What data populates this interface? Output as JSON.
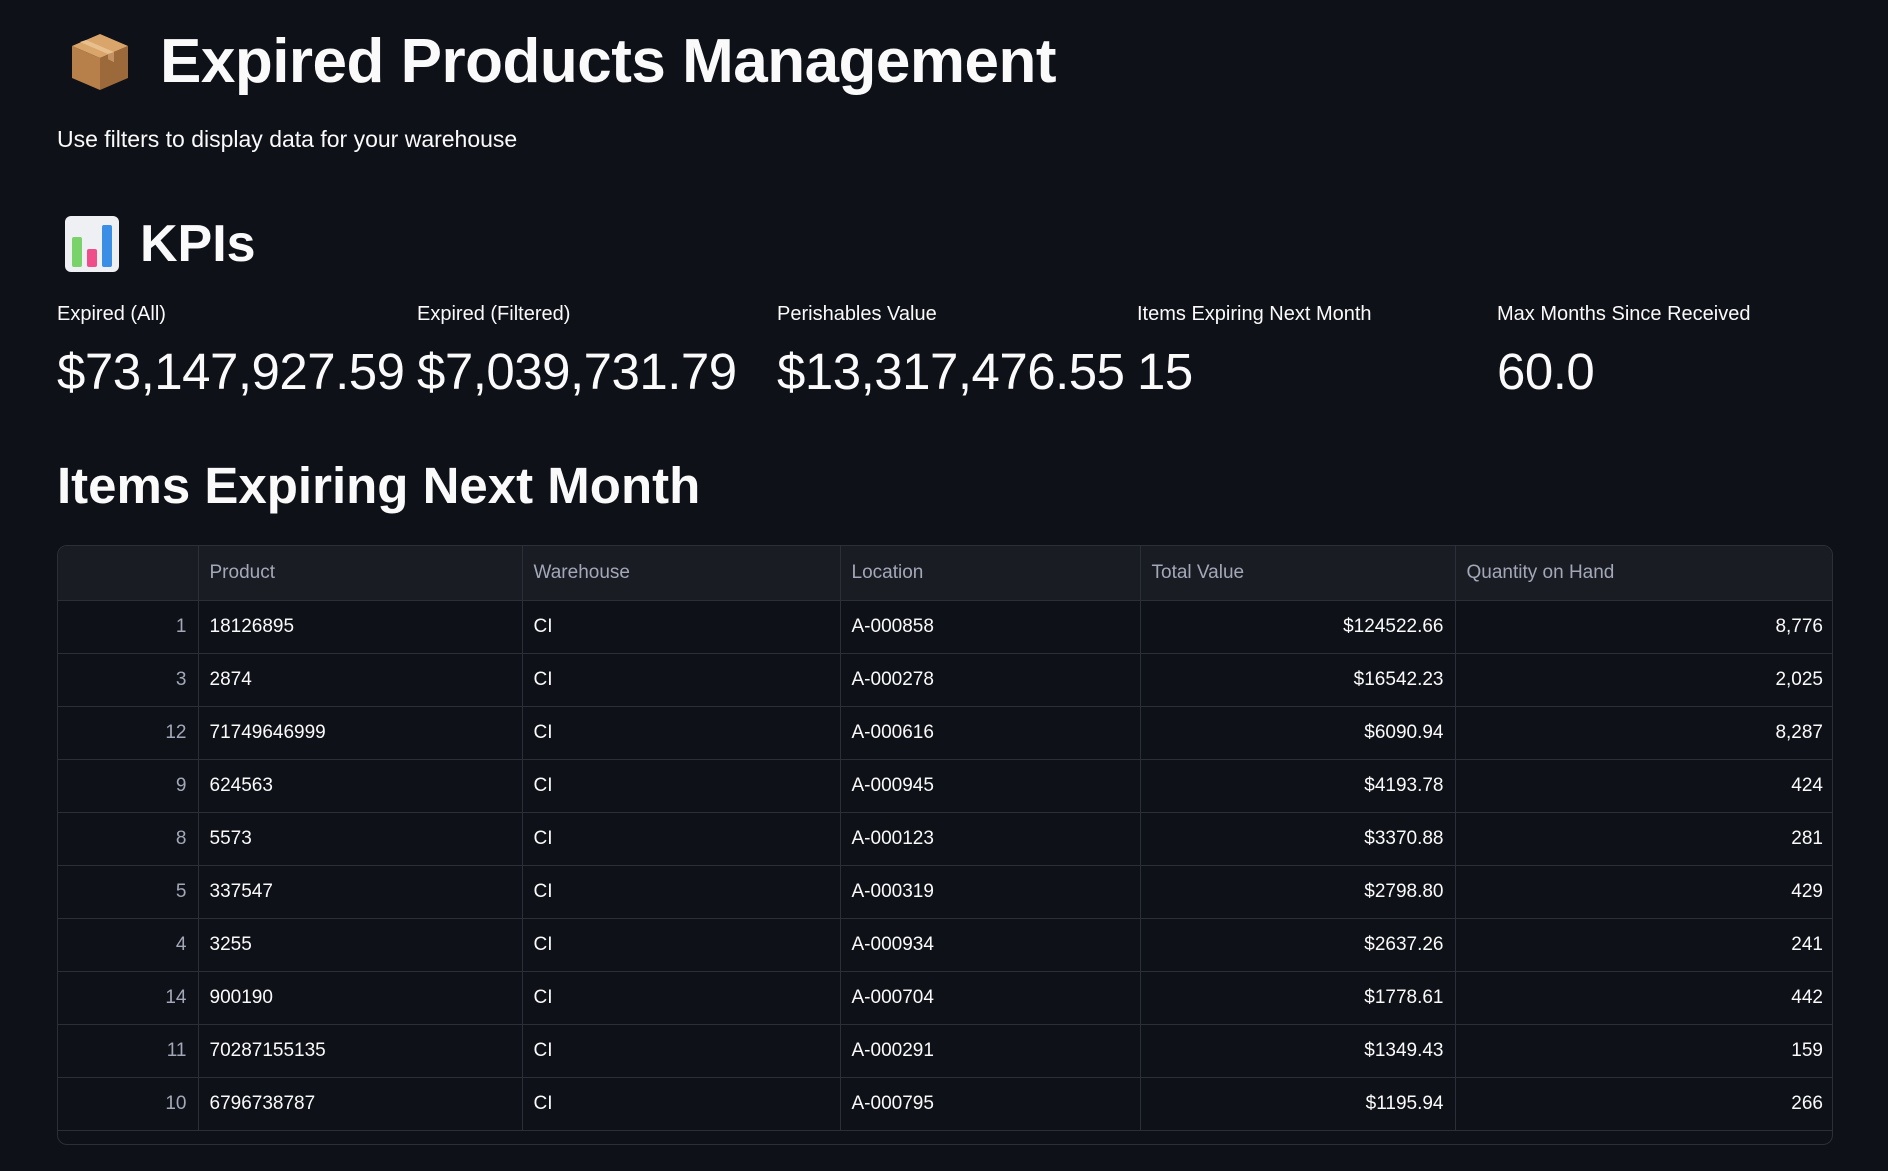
{
  "header": {
    "title": "Expired Products Management",
    "title_icon": "package-icon",
    "subtitle": "Use filters to display data for your warehouse"
  },
  "kpis": {
    "heading": "KPIs",
    "heading_icon": "bar-chart-icon",
    "metrics": [
      {
        "label": "Expired (All)",
        "value": "$73,147,927.59"
      },
      {
        "label": "Expired (Filtered)",
        "value": "$7,039,731.79"
      },
      {
        "label": "Perishables Value",
        "value": "$13,317,476.55"
      },
      {
        "label": "Items Expiring Next Month",
        "value": "15"
      },
      {
        "label": "Max Months Since Received",
        "value": "60.0"
      }
    ]
  },
  "expiring": {
    "heading": "Items Expiring Next Month",
    "columns": [
      "",
      "Product",
      "Warehouse",
      "Location",
      "Total Value",
      "Quantity on Hand"
    ],
    "rows": [
      {
        "index": "1",
        "product": "18126895",
        "warehouse": "CI",
        "location": "A-000858",
        "total_value": "$124522.66",
        "quantity": "8,776"
      },
      {
        "index": "3",
        "product": "2874",
        "warehouse": "CI",
        "location": "A-000278",
        "total_value": "$16542.23",
        "quantity": "2,025"
      },
      {
        "index": "12",
        "product": "71749646999",
        "warehouse": "CI",
        "location": "A-000616",
        "total_value": "$6090.94",
        "quantity": "8,287"
      },
      {
        "index": "9",
        "product": "624563",
        "warehouse": "CI",
        "location": "A-000945",
        "total_value": "$4193.78",
        "quantity": "424"
      },
      {
        "index": "8",
        "product": "5573",
        "warehouse": "CI",
        "location": "A-000123",
        "total_value": "$3370.88",
        "quantity": "281"
      },
      {
        "index": "5",
        "product": "337547",
        "warehouse": "CI",
        "location": "A-000319",
        "total_value": "$2798.80",
        "quantity": "429"
      },
      {
        "index": "4",
        "product": "3255",
        "warehouse": "CI",
        "location": "A-000934",
        "total_value": "$2637.26",
        "quantity": "241"
      },
      {
        "index": "14",
        "product": "900190",
        "warehouse": "CI",
        "location": "A-000704",
        "total_value": "$1778.61",
        "quantity": "442"
      },
      {
        "index": "11",
        "product": "70287155135",
        "warehouse": "CI",
        "location": "A-000291",
        "total_value": "$1349.43",
        "quantity": "159"
      },
      {
        "index": "10",
        "product": "6796738787",
        "warehouse": "CI",
        "location": "A-000795",
        "total_value": "$1195.94",
        "quantity": "266"
      }
    ]
  },
  "colors": {
    "background": "#0e1117",
    "text": "#fafafa",
    "muted_text": "#a3a8b8",
    "table_header_bg": "#1a1c24",
    "grid_line": "#2b2f38"
  }
}
